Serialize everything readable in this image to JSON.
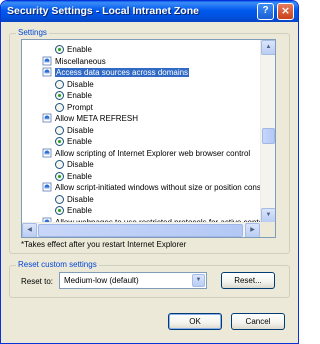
{
  "window": {
    "title": "Security Settings - Local Intranet Zone"
  },
  "settings": {
    "group_label": "Settings",
    "rows": [
      {
        "kind": "radio",
        "label": "Enable",
        "checked": true
      },
      {
        "kind": "category",
        "label": "Miscellaneous"
      },
      {
        "kind": "category",
        "label": "Access data sources across domains",
        "selected": true
      },
      {
        "kind": "radio",
        "label": "Disable",
        "checked": false
      },
      {
        "kind": "radio",
        "label": "Enable",
        "checked": true
      },
      {
        "kind": "radio",
        "label": "Prompt",
        "checked": false
      },
      {
        "kind": "category",
        "label": "Allow META REFRESH"
      },
      {
        "kind": "radio",
        "label": "Disable",
        "checked": false
      },
      {
        "kind": "radio",
        "label": "Enable",
        "checked": true
      },
      {
        "kind": "category",
        "label": "Allow scripting of Internet Explorer web browser control"
      },
      {
        "kind": "radio",
        "label": "Disable",
        "checked": false
      },
      {
        "kind": "radio",
        "label": "Enable",
        "checked": true
      },
      {
        "kind": "category",
        "label": "Allow script-initiated windows without size or position constra"
      },
      {
        "kind": "radio",
        "label": "Disable",
        "checked": false
      },
      {
        "kind": "radio",
        "label": "Enable",
        "checked": true
      },
      {
        "kind": "category",
        "label": "Allow webpages to use restricted protocols for active conten"
      }
    ],
    "note": "*Takes effect after you restart Internet Explorer"
  },
  "reset": {
    "group_label": "Reset custom settings",
    "reset_to_label": "Reset to:",
    "level_value": "Medium-low (default)",
    "reset_button": "Reset..."
  },
  "buttons": {
    "ok": "OK",
    "cancel": "Cancel"
  },
  "colors": {
    "accent": "#0046d5",
    "selection": "#316ac5",
    "titlebar": "#0058ee"
  }
}
